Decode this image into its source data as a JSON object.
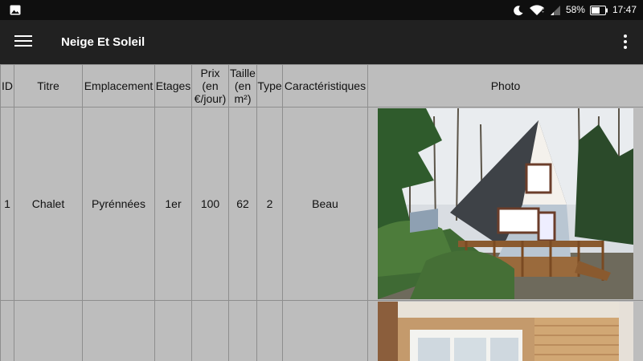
{
  "status_bar": {
    "battery": "58%",
    "time": "17:47",
    "icons": [
      "image-notification-icon",
      "moon-icon",
      "wifi-icon",
      "cell-signal-icon",
      "battery-icon"
    ]
  },
  "app_bar": {
    "title": "Neige Et Soleil",
    "icons": [
      "hamburger-menu-icon",
      "more-vert-icon"
    ]
  },
  "table": {
    "headers": {
      "id": "ID",
      "title": "Titre",
      "location": "Emplacement",
      "floors": "Etages",
      "price": "Prix (en €/jour)",
      "size": "Taille (en m²)",
      "type": "Type",
      "features": "Caractéristiques",
      "photo": "Photo"
    },
    "rows": [
      {
        "id": "1",
        "title": "Chalet",
        "location": "Pyrénnées",
        "floors": "1er",
        "price": "100",
        "size": "62",
        "type": "2",
        "features": "Beau",
        "photo": "a-frame-chalet-photo"
      },
      {
        "id": "",
        "title": "",
        "location": "",
        "floors": "",
        "price": "",
        "size": "",
        "type": "",
        "features": "",
        "photo": "wooden-interior-photo"
      }
    ]
  },
  "colors": {
    "status_bar_bg": "#0f0f0f",
    "app_bar_bg": "#212121",
    "table_bg": "#bdbdbd",
    "grid_line": "#8e8e8e"
  }
}
